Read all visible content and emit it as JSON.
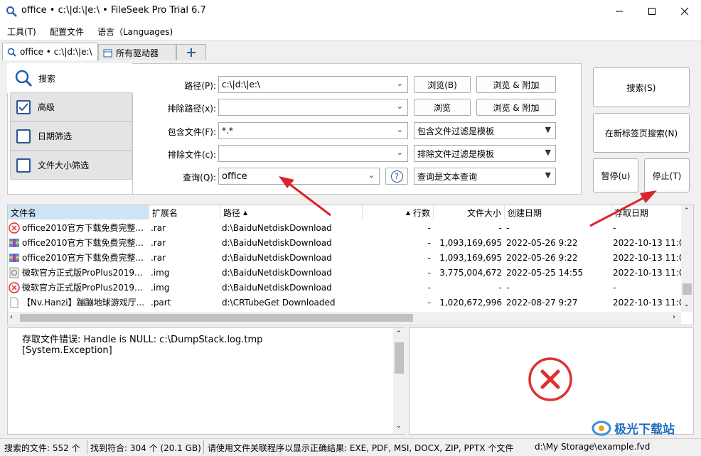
{
  "window": {
    "title": "office • c:\\|d:\\|e:\\ • FileSeek Pro Trial 6.7"
  },
  "menu": [
    "工具(T)",
    "配置文件",
    "语言（Languages)"
  ],
  "tabs": [
    {
      "label": "office • c:\\|d:\\|e:\\"
    },
    {
      "label": "所有驱动器"
    }
  ],
  "nav": {
    "search": "搜索",
    "advanced": "高级",
    "date_filter": "日期筛选",
    "size_filter": "文件大小筛选"
  },
  "form": {
    "path_label": "路径(P):",
    "path_value": "c:\\|d:\\|e:\\",
    "exclude_path_label": "排除路径(x):",
    "exclude_path_value": "",
    "include_label": "包含文件(F):",
    "include_value": "*.*",
    "exclude_file_label": "排除文件(c):",
    "exclude_file_value": "",
    "query_label": "查询(Q):",
    "query_value": "office",
    "browse_b": "浏览(B)",
    "browse_add": "浏览 & 附加",
    "browse": "浏览",
    "browse_add2": "浏览 & 附加",
    "include_mode": "包含文件过滤是模板",
    "exclude_mode": "排除文件过滤是模板",
    "query_mode": "查询是文本查询",
    "help": "?"
  },
  "actions": {
    "search": "搜索(S)",
    "new_tab_search": "在新标签页搜索(N)",
    "pause": "暂停(u)",
    "stop": "停止(T)"
  },
  "results": {
    "columns": [
      "文件名",
      "扩展名",
      "路径",
      "行数",
      "文件大小",
      "创建日期",
      "存取日期"
    ],
    "rows": [
      {
        "icon": "error",
        "name": "office2010官方下载免费完整...",
        "ext": ".rar",
        "path": "d:\\BaiduNetdiskDownload",
        "lines": "-",
        "size": "-",
        "created": "-",
        "accessed": "-"
      },
      {
        "icon": "archive",
        "name": "office2010官方下载免费完整...",
        "ext": ".rar",
        "path": "d:\\BaiduNetdiskDownload",
        "lines": "-",
        "size": "1,093,169,695",
        "created": "2022-05-26 9:22",
        "accessed": "2022-10-13 11:0"
      },
      {
        "icon": "archive",
        "name": "office2010官方下载免费完整...",
        "ext": ".rar",
        "path": "d:\\BaiduNetdiskDownload",
        "lines": "-",
        "size": "1,093,169,695",
        "created": "2022-05-26 9:22",
        "accessed": "2022-10-13 11:0"
      },
      {
        "icon": "disc",
        "name": "微软官方正式版ProPlus2019...",
        "ext": ".img",
        "path": "d:\\BaiduNetdiskDownload",
        "lines": "-",
        "size": "3,775,004,672",
        "created": "2022-05-25 14:55",
        "accessed": "2022-10-13 11:0"
      },
      {
        "icon": "error",
        "name": "微软官方正式版ProPlus2019...",
        "ext": ".img",
        "path": "d:\\BaiduNetdiskDownload",
        "lines": "-",
        "size": "-",
        "created": "-",
        "accessed": "-"
      },
      {
        "icon": "file",
        "name": "【Nv.Hanzi】蹦蹦地球游戏厅...",
        "ext": ".part",
        "path": "d:\\CRTubeGet Downloaded",
        "lines": "-",
        "size": "1,020,672,996",
        "created": "2022-08-27 9:27",
        "accessed": "2022-10-13 11:0"
      }
    ]
  },
  "log": {
    "line1": "存取文件错误: Handle is NULL: c:\\DumpStack.log.tmp",
    "line2": "[System.Exception]"
  },
  "status": {
    "searched": "搜索的文件: 552 个",
    "found": "找到符合: 304 个 (20.1 GB)",
    "hint": "请使用文件关联程序以显示正确结果: EXE, PDF, MSI, DOCX, ZIP, PPTX 个文件",
    "profile": "d:\\My Storage\\example.fvd"
  },
  "watermark": "极光下载站",
  "colors": {
    "accent": "#2b5797",
    "error": "#e03030",
    "arrow": "#d9262c"
  }
}
